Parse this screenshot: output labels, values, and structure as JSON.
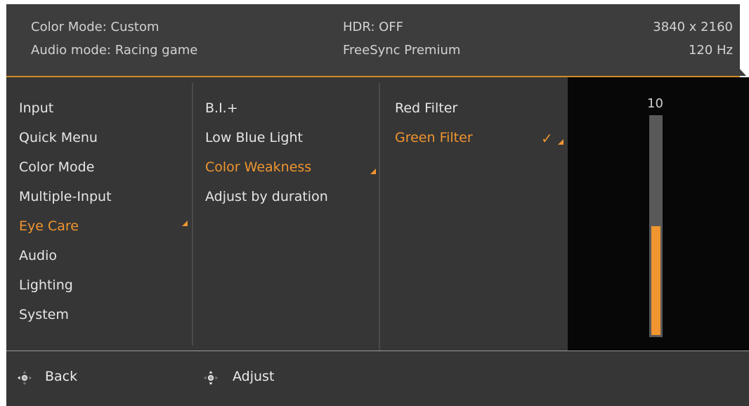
{
  "header": {
    "color_mode": "Color Mode: Custom",
    "audio_mode": "Audio mode: Racing game",
    "hdr": "HDR: OFF",
    "freesync": "FreeSync Premium",
    "resolution": "3840 x 2160",
    "refresh": "120 Hz"
  },
  "main_menu": {
    "items": [
      {
        "label": "Input"
      },
      {
        "label": "Quick Menu"
      },
      {
        "label": "Color Mode"
      },
      {
        "label": "Multiple-Input"
      },
      {
        "label": "Eye Care",
        "active": true
      },
      {
        "label": "Audio"
      },
      {
        "label": "Lighting"
      },
      {
        "label": "System"
      }
    ]
  },
  "sub_menu": {
    "items": [
      {
        "label": "B.I.+"
      },
      {
        "label": "Low Blue Light"
      },
      {
        "label": "Color Weakness",
        "active": true
      },
      {
        "label": "Adjust by duration"
      }
    ]
  },
  "option_menu": {
    "items": [
      {
        "label": "Red Filter"
      },
      {
        "label": "Green Filter",
        "active": true,
        "checked": true
      }
    ]
  },
  "slider": {
    "value": "10",
    "level_fraction": 0.5
  },
  "footer": {
    "back_label": "Back",
    "adjust_label": "Adjust",
    "back_icon": "joystick-left-icon",
    "adjust_icon": "joystick-updown-icon"
  },
  "colors": {
    "accent": "#f0952f",
    "panel": "#363636",
    "header": "#3d3d3d"
  }
}
